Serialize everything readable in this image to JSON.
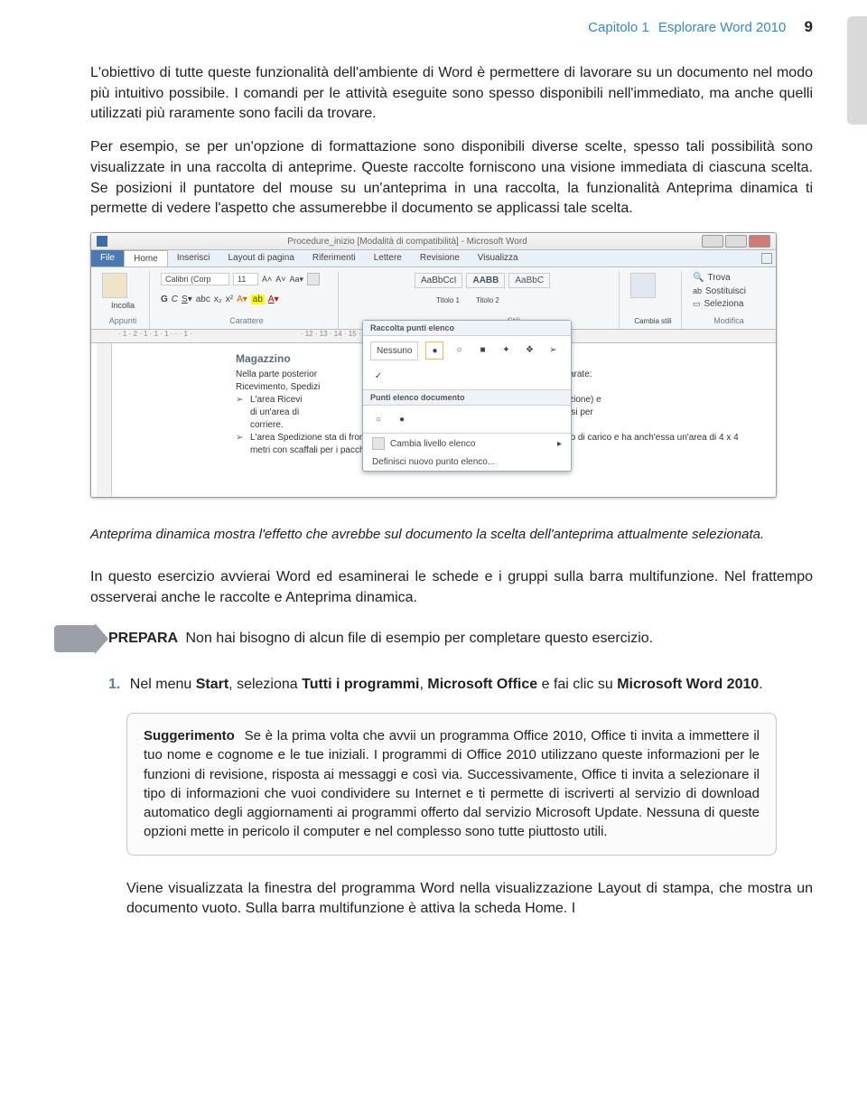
{
  "header": {
    "chapter": "Capitolo 1",
    "title": "Esplorare Word 2010",
    "page": "9"
  },
  "para1": "L'obiettivo di tutte queste funzionalità dell'ambiente di Word è permettere di lavorare su un documento nel modo più intuitivo possibile. I comandi per le attività eseguite sono spesso disponibili nell'immediato, ma anche quelli utilizzati più raramente sono facili da trovare.",
  "para2": "Per esempio, se per un'opzione di formattazione sono disponibili diverse scelte, spesso tali possibilità sono visualizzate in una raccolta di anteprime. Queste raccolte forniscono una visione immediata di ciascuna scelta. Se posizioni il puntatore del mouse su un'anteprima in una raccolta, la funzionalità Anteprima dinamica ti permette di vedere l'aspetto che assumerebbe il documento se applicassi tale scelta.",
  "screenshot": {
    "window_title": "Procedure_inizio [Modalità di compatibilità] - Microsoft Word",
    "tabs": [
      "File",
      "Home",
      "Inserisci",
      "Layout di pagina",
      "Riferimenti",
      "Lettere",
      "Revisione",
      "Visualizza"
    ],
    "clipboard_group": "Appunti",
    "paste_label": "Incolla",
    "font_group": "Carattere",
    "font_name": "Calibri (Corp",
    "font_size": "11",
    "style1": "AaBbCcI",
    "style2": "AABB",
    "style3": "AaBbC",
    "style1_label": "",
    "style2_label": "Titolo 1",
    "style3_label": "Titolo 2",
    "styles_group": "Stili",
    "change_styles": "Cambia stili",
    "editing_group": "Modifica",
    "find": "Trova",
    "replace": "Sostituisci",
    "select": "Seleziona",
    "popup_title1": "Raccolta punti elenco",
    "popup_none": "Nessuno",
    "popup_title2": "Punti elenco documento",
    "popup_change": "Cambia livello elenco",
    "popup_define": "Definisci nuovo punto elenco...",
    "doc_heading": "Magazzino",
    "doc_line1_a": "Nella parte posterior",
    "doc_line1_b": "aree separate:",
    "doc_line2": "Ricevimento, Spedizi",
    "doc_b1_a": "L'area Ricevi",
    "doc_b1_b": "ne per la spedizione) e",
    "doc_b2_a": "di un'area di",
    "doc_b2_b": "affali sono divisi per",
    "doc_b2_c": "corriere.",
    "doc_b3": "L'area Spedizione sta di fronte all'area Ricevimento, condivide con essa lo spazio di carico e ha anch'essa un'area di 4 x 4 metri con scaffali per i pacchi in attesa di essere"
  },
  "caption": "Anteprima dinamica mostra l'effetto che avrebbe sul documento la scelta dell'anteprima attualmente selezionata.",
  "para3": "In questo esercizio avvierai Word ed esaminerai le schede e i gruppi sulla barra multifunzione. Nel frattempo osserverai anche le raccolte e Anteprima dinamica.",
  "prepara": {
    "label": "PREPARA",
    "text": "Non hai bisogno di alcun file di esempio per completare questo esercizio."
  },
  "step1": {
    "num": "1.",
    "t1": "Nel menu ",
    "b1": "Start",
    "t2": ", seleziona ",
    "b2": "Tutti i programmi",
    "t3": ", ",
    "b3": "Microsoft Office",
    "t4": " e fai clic su ",
    "b4": "Microsoft Word 2010",
    "t5": "."
  },
  "tip": {
    "title": "Suggerimento",
    "text": "Se è la prima volta che avvii un programma Office 2010, Office ti invita a immettere il tuo nome e cognome e le tue iniziali. I programmi di Office 2010 utilizzano queste informazioni per le funzioni di revisione, risposta ai messaggi e così via. Successivamente, Office ti invita a selezionare il tipo di informazioni che vuoi condividere su Internet e ti permette di iscriverti al servizio di download automatico degli aggiornamenti ai programmi offerto dal servizio Microsoft Update. Nessuna di queste opzioni mette in pericolo il computer e nel complesso sono tutte piuttosto utili."
  },
  "para4": "Viene visualizzata la finestra del programma Word nella visualizzazione Layout di stampa, che mostra un documento vuoto. Sulla barra multifunzione è attiva la scheda Home. I"
}
